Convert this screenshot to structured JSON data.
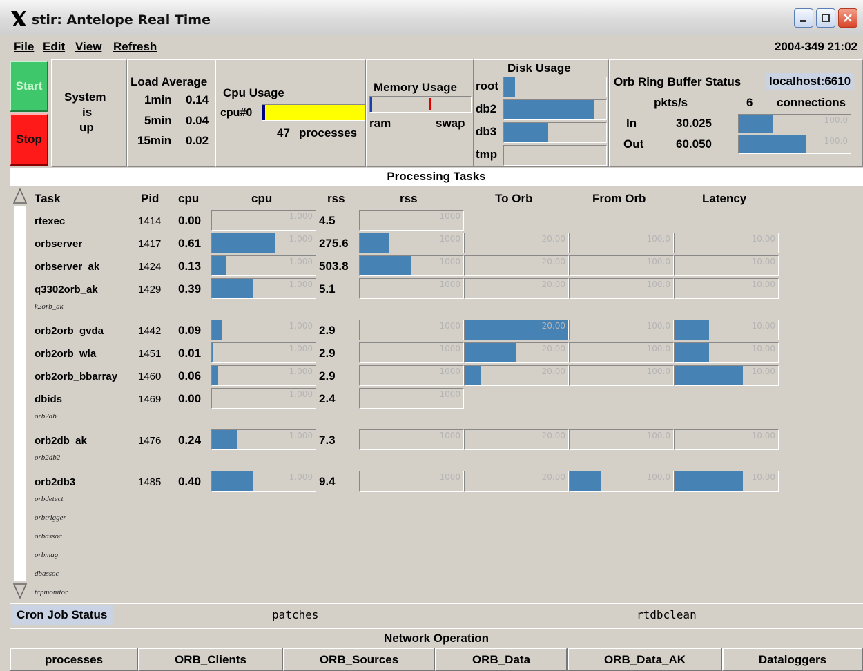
{
  "window": {
    "title": "stir: Antelope Real Time"
  },
  "menu": {
    "file": "File",
    "edit": "Edit",
    "view": "View",
    "refresh": "Refresh",
    "datetime": "2004-349 21:02"
  },
  "controls": {
    "start": "Start",
    "stop": "Stop",
    "status_1": "System",
    "status_2": "is",
    "status_3": "up"
  },
  "load": {
    "title": "Load Average",
    "rows": [
      {
        "label": "1min",
        "value": "0.14"
      },
      {
        "label": "5min",
        "value": "0.04"
      },
      {
        "label": "15min",
        "value": "0.02"
      }
    ]
  },
  "cpu": {
    "title": "Cpu Usage",
    "cpu_label": "cpu#0",
    "processes": "47",
    "processes_label": "processes",
    "fill": 0.03
  },
  "memory": {
    "title": "Memory Usage",
    "ram": "ram",
    "swap": "swap",
    "ram_fill": 0.02,
    "swap_marker": 0.58
  },
  "disk": {
    "title": "Disk Usage",
    "items": [
      {
        "name": "root",
        "fill": 0.11
      },
      {
        "name": "db2",
        "fill": 0.88
      },
      {
        "name": "db3",
        "fill": 0.43
      },
      {
        "name": "tmp",
        "fill": 0.0
      }
    ]
  },
  "orb": {
    "title": "Orb Ring Buffer Status",
    "host": "localhost:6610",
    "pkts": "pkts/s",
    "connections_count": "6",
    "connections": "connections",
    "in_label": "In",
    "in_value": "30.025",
    "in_scale": "100.0",
    "in_fill": 0.3,
    "out_label": "Out",
    "out_value": "60.050",
    "out_scale": "100.0",
    "out_fill": 0.6
  },
  "tasks": {
    "header": "Processing Tasks",
    "columns": {
      "task": "Task",
      "pid": "Pid",
      "cpu": "cpu",
      "cpu_bar": "cpu",
      "rss": "rss",
      "rss_bar": "rss",
      "to_orb": "To Orb",
      "from_orb": "From Orb",
      "latency": "Latency"
    },
    "scales": {
      "cpu": "1.000",
      "rss": "1000",
      "to_orb": "20.00",
      "from_orb": "100.0",
      "latency": "10.00"
    },
    "rows": [
      {
        "name": "rtexec",
        "pid": "1414",
        "cpu": "0.00",
        "rss": "4.5",
        "cpu_fill": 0.0,
        "rss_fill": 0.0,
        "to": null,
        "from": null,
        "lat": null
      },
      {
        "name": "orbserver",
        "pid": "1417",
        "cpu": "0.61",
        "rss": "275.6",
        "cpu_fill": 0.61,
        "rss_fill": 0.28,
        "to": 0.0,
        "from": 0.0,
        "lat": 0.0
      },
      {
        "name": "orbserver_ak",
        "pid": "1424",
        "cpu": "0.13",
        "rss": "503.8",
        "cpu_fill": 0.13,
        "rss_fill": 0.5,
        "to": 0.0,
        "from": 0.0,
        "lat": 0.0
      },
      {
        "name": "q3302orb_ak",
        "pid": "1429",
        "cpu": "0.39",
        "rss": "5.1",
        "cpu_fill": 0.39,
        "rss_fill": 0.0,
        "to": 0.0,
        "from": 0.0,
        "lat": 0.0
      },
      {
        "sub": "k2orb_ak"
      },
      {
        "name": "orb2orb_gvda",
        "pid": "1442",
        "cpu": "0.09",
        "rss": "2.9",
        "cpu_fill": 0.09,
        "rss_fill": 0.0,
        "to": 1.0,
        "from": 0.0,
        "lat": 0.33
      },
      {
        "name": "orb2orb_wla",
        "pid": "1451",
        "cpu": "0.01",
        "rss": "2.9",
        "cpu_fill": 0.01,
        "rss_fill": 0.0,
        "to": 0.5,
        "from": 0.0,
        "lat": 0.33
      },
      {
        "name": "orb2orb_bbarray",
        "pid": "1460",
        "cpu": "0.06",
        "rss": "2.9",
        "cpu_fill": 0.06,
        "rss_fill": 0.0,
        "to": 0.16,
        "from": 0.0,
        "lat": 0.66
      },
      {
        "name": "dbids",
        "pid": "1469",
        "cpu": "0.00",
        "rss": "2.4",
        "cpu_fill": 0.0,
        "rss_fill": 0.0,
        "to": null,
        "from": null,
        "lat": null
      },
      {
        "sub": "orb2db"
      },
      {
        "name": "orb2db_ak",
        "pid": "1476",
        "cpu": "0.24",
        "rss": "7.3",
        "cpu_fill": 0.24,
        "rss_fill": 0.0,
        "to": 0.0,
        "from": 0.0,
        "lat": 0.0
      },
      {
        "sub": "orb2db2"
      },
      {
        "name": "orb2db3",
        "pid": "1485",
        "cpu": "0.40",
        "rss": "9.4",
        "cpu_fill": 0.4,
        "rss_fill": 0.0,
        "to": 0.0,
        "from": 0.3,
        "lat": 0.66
      },
      {
        "sub": "orbdetect"
      },
      {
        "sub": "orbtrigger"
      },
      {
        "sub": "orbassoc"
      },
      {
        "sub": "orbmag"
      },
      {
        "sub": "dbassoc"
      },
      {
        "sub": "tcpmonitor"
      }
    ]
  },
  "cron": {
    "title": "Cron Job Status",
    "item1": "patches",
    "item2": "rtdbclean"
  },
  "network": {
    "title": "Network Operation",
    "buttons": [
      "processes",
      "ORB_Clients",
      "ORB_Sources",
      "ORB_Data",
      "ORB_Data_AK",
      "Dataloggers"
    ]
  },
  "colors": {
    "bar": "#4682b4",
    "cpu_yellow": "#ffff00",
    "start": "#3ec86b",
    "stop": "#ff1a1a"
  }
}
